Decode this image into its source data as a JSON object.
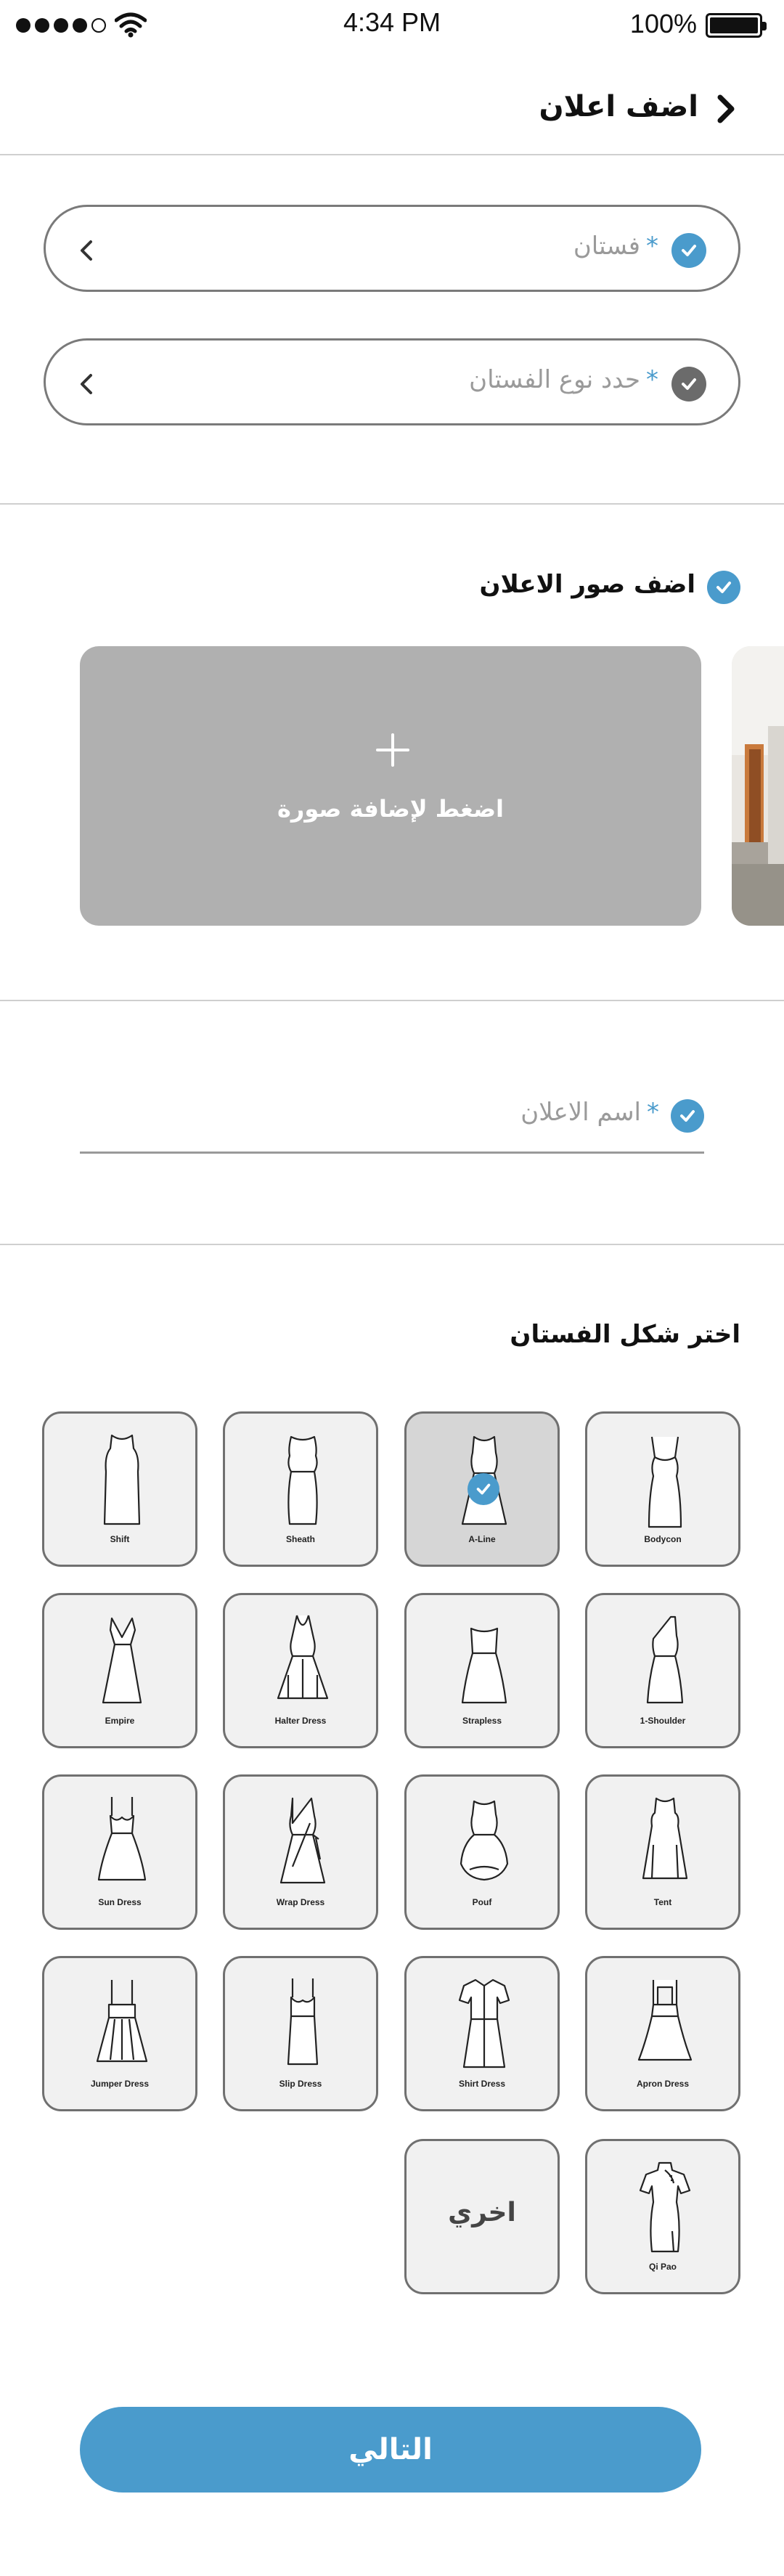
{
  "status_bar": {
    "time": "4:34 PM",
    "battery": "100%",
    "signal_dots_filled": 4,
    "signal_dots_total": 5
  },
  "header": {
    "title": "اضف اعلان",
    "back_icon": "chevron-right-icon"
  },
  "form": {
    "category": {
      "value": "فستان",
      "required_mark": "*",
      "status": "checked"
    },
    "dress_type": {
      "placeholder": "حدد نوع الفستان",
      "required_mark": "*",
      "status": "unchecked"
    }
  },
  "images": {
    "title": "اضف صور الاعلان",
    "add_label": "اضغط لإضافة صورة"
  },
  "ad_name": {
    "placeholder": "اسم الاعلان",
    "required_mark": "*"
  },
  "dress_shape": {
    "title": "اختر شكل الفستان",
    "selected": "A-Line",
    "options": [
      {
        "name": "Bodycon",
        "icon": "bodycon-dress-icon"
      },
      {
        "name": "A-Line",
        "icon": "a-line-dress-icon"
      },
      {
        "name": "Sheath",
        "icon": "sheath-dress-icon"
      },
      {
        "name": "Shift",
        "icon": "shift-dress-icon"
      },
      {
        "name": "1-Shoulder",
        "icon": "one-shoulder-dress-icon"
      },
      {
        "name": "Strapless",
        "icon": "strapless-dress-icon"
      },
      {
        "name": "Halter Dress",
        "icon": "halter-dress-icon"
      },
      {
        "name": "Empire",
        "icon": "empire-dress-icon"
      },
      {
        "name": "Tent",
        "icon": "tent-dress-icon"
      },
      {
        "name": "Pouf",
        "icon": "pouf-dress-icon"
      },
      {
        "name": "Wrap Dress",
        "icon": "wrap-dress-icon"
      },
      {
        "name": "Sun Dress",
        "icon": "sun-dress-icon"
      },
      {
        "name": "Apron Dress",
        "icon": "apron-dress-icon"
      },
      {
        "name": "Shirt Dress",
        "icon": "shirt-dress-icon"
      },
      {
        "name": "Slip Dress",
        "icon": "slip-dress-icon"
      },
      {
        "name": "Jumper Dress",
        "icon": "jumper-dress-icon"
      },
      {
        "name": "Qi Pao",
        "icon": "qi-pao-dress-icon"
      }
    ],
    "other_label": "اخري"
  },
  "next_button": "التالي",
  "colors": {
    "accent": "#4a9bcc",
    "tile_bg": "#f1f1f1",
    "tile_selected_bg": "#d6d6d6",
    "photo_placeholder": "#b0b0b0"
  }
}
